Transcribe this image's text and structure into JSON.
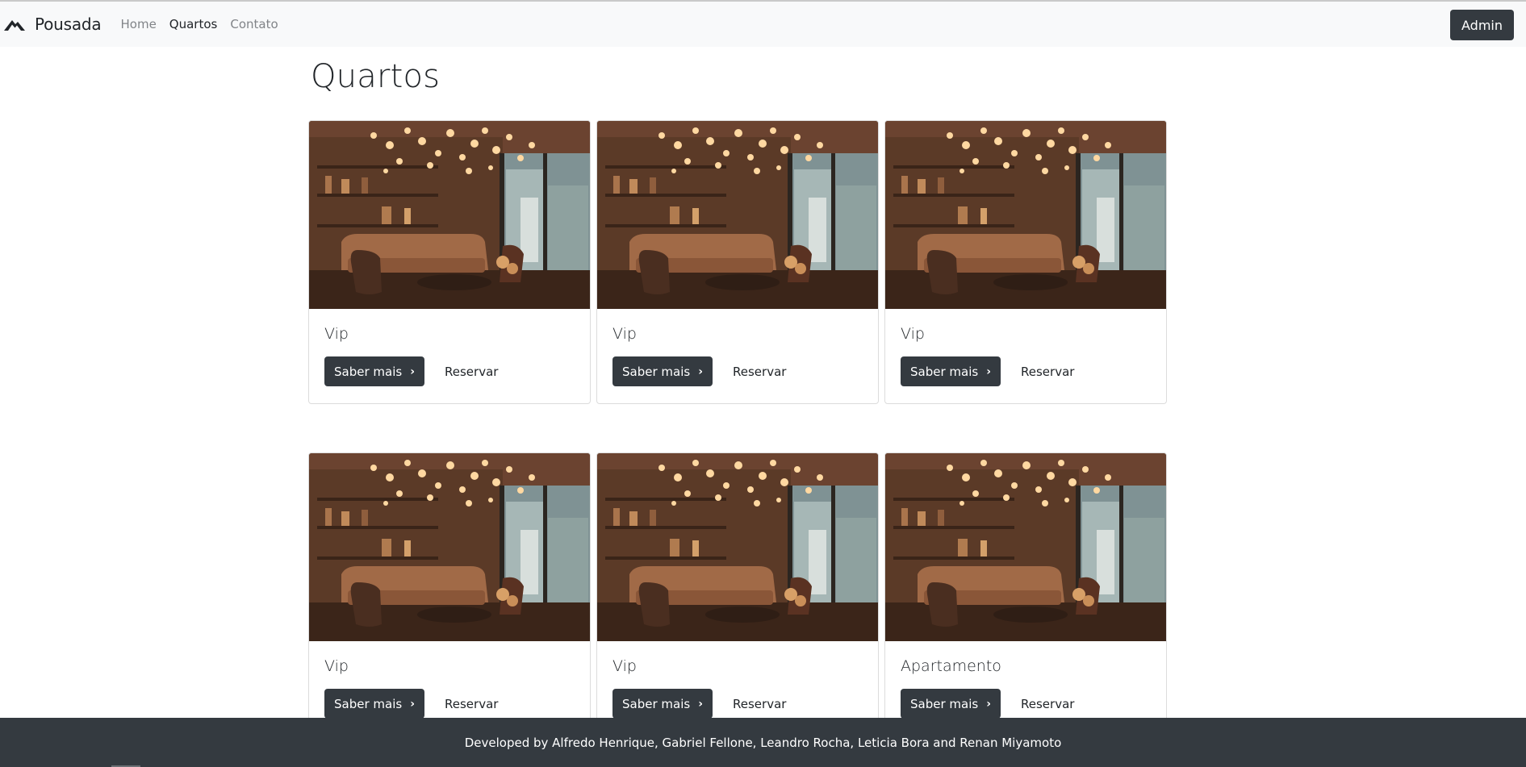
{
  "navbar": {
    "brand": "Pousada",
    "links": [
      {
        "label": "Home",
        "active": false
      },
      {
        "label": "Quartos",
        "active": true
      },
      {
        "label": "Contato",
        "active": false
      }
    ],
    "admin_label": "Admin"
  },
  "page": {
    "title": "Quartos"
  },
  "cards": [
    {
      "title": "Vip",
      "more_label": "Saber mais",
      "reserve_label": "Reservar"
    },
    {
      "title": "Vip",
      "more_label": "Saber mais",
      "reserve_label": "Reservar"
    },
    {
      "title": "Vip",
      "more_label": "Saber mais",
      "reserve_label": "Reservar"
    },
    {
      "title": "Vip",
      "more_label": "Saber mais",
      "reserve_label": "Reservar"
    },
    {
      "title": "Vip",
      "more_label": "Saber mais",
      "reserve_label": "Reservar"
    },
    {
      "title": "Apartamento",
      "more_label": "Saber mais",
      "reserve_label": "Reservar"
    }
  ],
  "footer": {
    "text": "Developed by Alfredo Henrique, Gabriel Fellone, Leandro Rocha, Leticia Bora and Renan Miyamoto"
  },
  "colors": {
    "navbar_bg": "#f8f9fa",
    "dark": "#343a40",
    "text": "#212529",
    "muted": "#818488"
  },
  "icons": {
    "brand": "mountain-logo-icon",
    "button": "chevron-right-icon"
  }
}
